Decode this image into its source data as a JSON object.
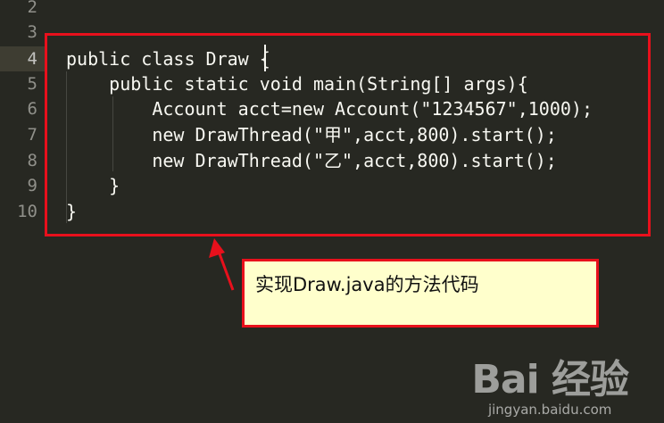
{
  "gutter": {
    "line_numbers": [
      "2",
      "3",
      "4",
      "5",
      "6",
      "7",
      "8",
      "9",
      "10"
    ]
  },
  "code": {
    "lines": [
      "",
      "",
      "public class Draw {",
      "    public static void main(String[] args){",
      "        Account acct=new Account(\"1234567\",1000);",
      "        new DrawThread(\"甲\",acct,800).start();",
      "        new DrawThread(\"乙\",acct,800).start();",
      "    }",
      "}"
    ]
  },
  "callout": {
    "text": "实现Draw.java的方法代码"
  },
  "watermark": {
    "logo": "Bai 经验",
    "url": "jingyan.baidu.com"
  },
  "colors": {
    "background": "#272822",
    "highlight_border": "#e8101c",
    "callout_fill": "#ffffcc",
    "text": "#f8f8f2"
  }
}
